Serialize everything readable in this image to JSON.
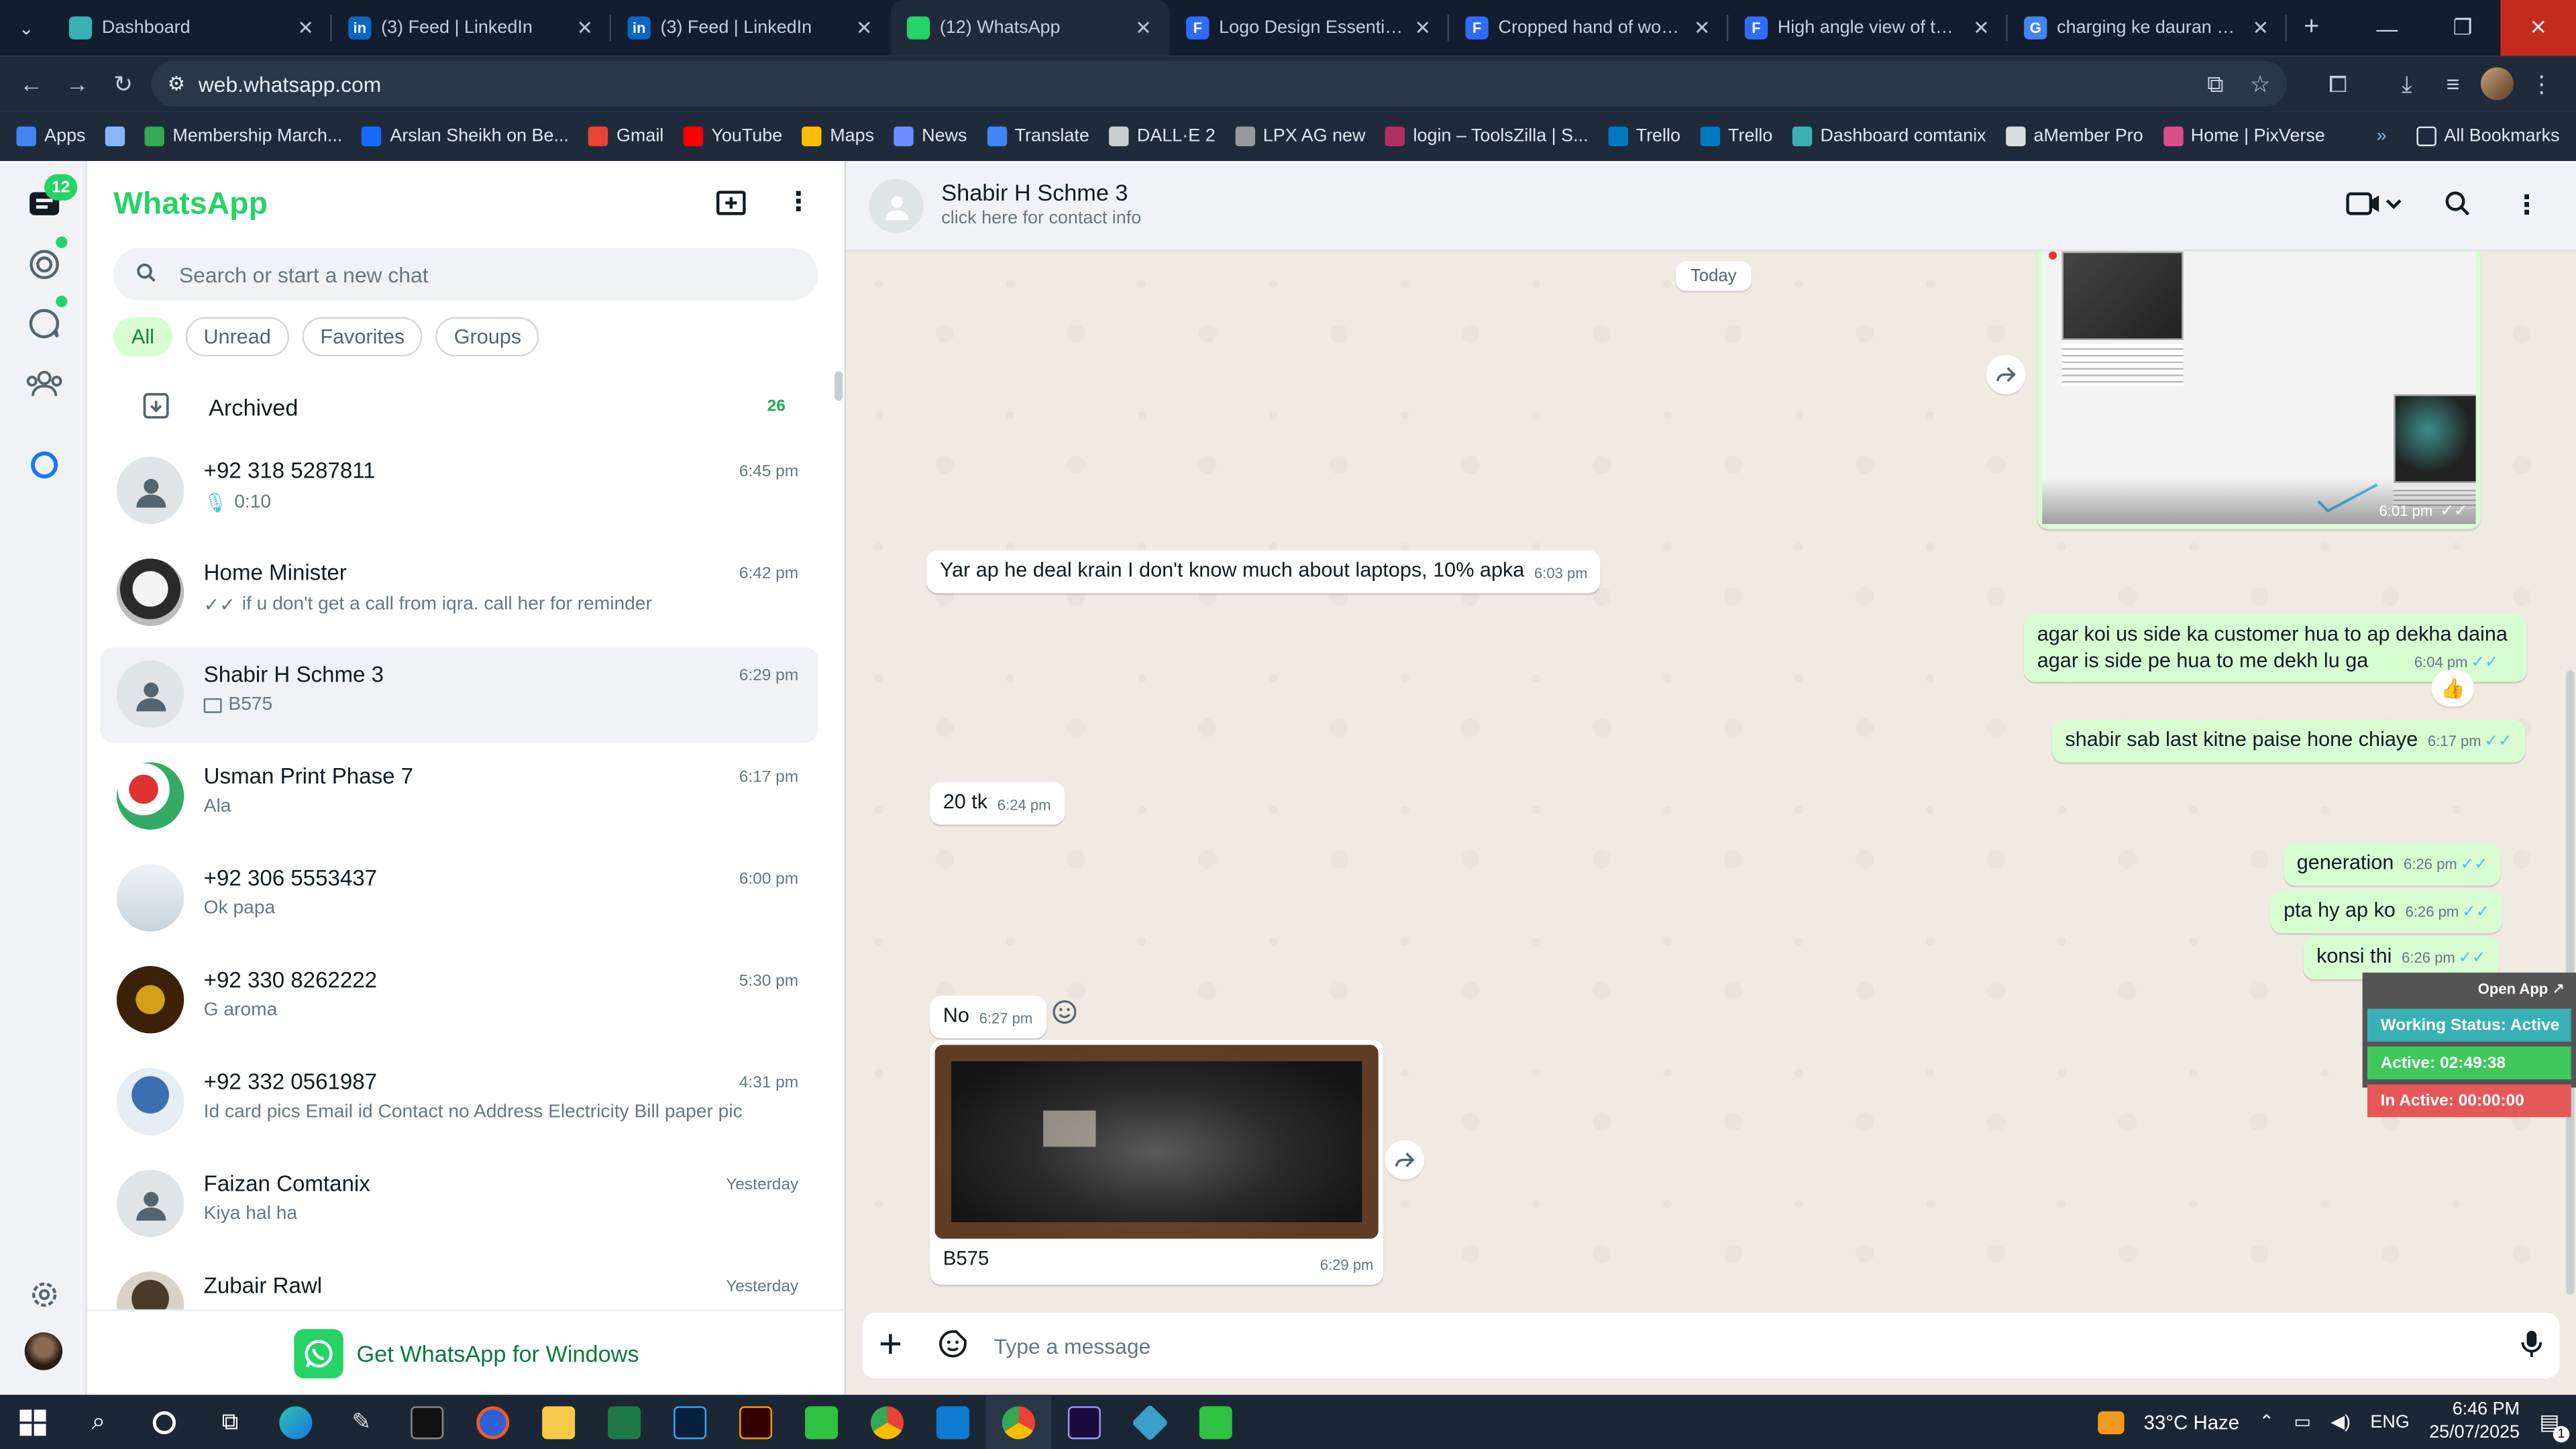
{
  "browser": {
    "tabs": [
      {
        "title": "Dashboard",
        "color": "#38b1b5",
        "letter": ""
      },
      {
        "title": "(3) Feed | LinkedIn",
        "color": "#0a66c2",
        "letter": "in"
      },
      {
        "title": "(3) Feed | LinkedIn",
        "color": "#0a66c2",
        "letter": "in"
      },
      {
        "title": "(12) WhatsApp",
        "color": "#25d366",
        "letter": ""
      },
      {
        "title": "Logo Design Essentials ve",
        "color": "#2f6bff",
        "letter": "F"
      },
      {
        "title": "Cropped hand of woman",
        "color": "#2f6bff",
        "letter": "F"
      },
      {
        "title": "High angle view of toys s",
        "color": "#2f6bff",
        "letter": "F"
      },
      {
        "title": "charging ke dauran hone",
        "color": "#4285f4",
        "letter": "G"
      }
    ],
    "url": "web.whatsapp.com",
    "bookmarks": [
      {
        "label": "Apps",
        "color": "#4285f4"
      },
      {
        "label": "",
        "color": "#8ab4f8"
      },
      {
        "label": "Membership March...",
        "color": "#34a853"
      },
      {
        "label": "Arslan Sheikh on Be...",
        "color": "#1769ff"
      },
      {
        "label": "Gmail",
        "color": "#ea4335"
      },
      {
        "label": "YouTube",
        "color": "#ff0000"
      },
      {
        "label": "Maps",
        "color": "#fbbc04"
      },
      {
        "label": "News",
        "color": "#6c8cff"
      },
      {
        "label": "Translate",
        "color": "#4285f4"
      },
      {
        "label": "DALL·E 2",
        "color": "#cccccc"
      },
      {
        "label": "LPX AG new",
        "color": "#999999"
      },
      {
        "label": "login – ToolsZilla | S...",
        "color": "#b03060"
      },
      {
        "label": "Trello",
        "color": "#0079bf"
      },
      {
        "label": "Trello",
        "color": "#0079bf"
      },
      {
        "label": "Dashboard comtanix",
        "color": "#38b1b5"
      },
      {
        "label": "aMember Pro",
        "color": "#dddddd"
      },
      {
        "label": "Home | PixVerse",
        "color": "#d94f8a"
      }
    ],
    "all_bookmarks": "All Bookmarks"
  },
  "rail": {
    "chats_badge": "12"
  },
  "sidebar": {
    "title": "WhatsApp",
    "search_placeholder": "Search or start a new chat",
    "filters": [
      "All",
      "Unread",
      "Favorites",
      "Groups"
    ],
    "archived_label": "Archived",
    "archived_count": "26",
    "chats": [
      {
        "name": "+92 318 5287811",
        "preview": "0:10",
        "time": "6:45 pm",
        "icon": "mic"
      },
      {
        "name": "Home Minister",
        "preview": "if u don't get a call from iqra. call her for reminder",
        "time": "6:42 pm",
        "icon": "ticks"
      },
      {
        "name": "Shabir H  Schme 3",
        "preview": "B575",
        "time": "6:29 pm",
        "icon": "image"
      },
      {
        "name": "Usman Print Phase 7",
        "preview": "Ala",
        "time": "6:17 pm",
        "icon": ""
      },
      {
        "name": "+92 306 5553437",
        "preview": "Ok papa",
        "time": "6:00 pm",
        "icon": ""
      },
      {
        "name": "+92 330 8262222",
        "preview": "G aroma",
        "time": "5:30 pm",
        "icon": ""
      },
      {
        "name": "+92 332 0561987",
        "preview": "Id card pics Email id  Contact no Address Electricity Bill paper pic",
        "time": "4:31 pm",
        "icon": ""
      },
      {
        "name": "Faizan Comtanix",
        "preview": "Kiya hal ha",
        "time": "Yesterday",
        "icon": ""
      },
      {
        "name": "Zubair Rawl",
        "preview": "",
        "time": "Yesterday",
        "icon": ""
      }
    ],
    "get_windows": "Get WhatsApp for Windows"
  },
  "conversation": {
    "name": "Shabir H  Schme 3",
    "subtitle": "click here for contact info",
    "date_pill": "Today",
    "messages": {
      "m_img_out_time": "6:01 pm",
      "m1": {
        "text": "Yar ap he deal krain I don't know much about laptops, 10% apka",
        "time": "6:03 pm"
      },
      "m2a": "agar koi  us side ka customer hua to ap dekha daina",
      "m2b": "agar is side pe hua to me dekh lu ga",
      "m2_time": "6:04 pm",
      "m2_reaction": "👍",
      "m3": {
        "text": "shabir sab last kitne paise hone chiaye",
        "time": "6:17 pm"
      },
      "m4": {
        "text": "20 tk",
        "time": "6:24 pm"
      },
      "m5": {
        "text": "generation",
        "time": "6:26 pm"
      },
      "m6": {
        "text": "pta hy ap ko",
        "time": "6:26 pm"
      },
      "m7": {
        "text": "konsi thi",
        "time": "6:26 pm"
      },
      "m8": {
        "text": "No",
        "time": "6:27 pm"
      },
      "m9": {
        "caption": "B575",
        "time": "6:29 pm"
      }
    },
    "composer_placeholder": "Type a message"
  },
  "widget": {
    "open_app": "Open App ↗",
    "working_status": "Working Status: Active",
    "active": "Active: 02:49:38",
    "inactive": "In Active: 00:00:00"
  },
  "taskbar": {
    "weather": "33°C  Haze",
    "lang": "ENG",
    "time": "6:46 PM",
    "date": "25/07/2025",
    "notif_count": "1"
  }
}
